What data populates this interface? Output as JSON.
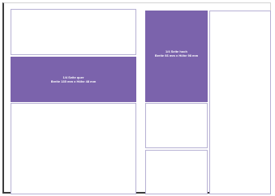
{
  "colors": {
    "ad_fill": "#7b63ac",
    "box_border": "#b7b1d4",
    "page_edge": "#3c3c3c"
  },
  "ads": [
    {
      "title": "1/4 Seite quer",
      "size": "Breite 135 mm x Höhe 48 mm"
    },
    {
      "title": "1/4 Seite hoch",
      "size": "Breite 66 mm x Höhe 98 mm"
    }
  ]
}
